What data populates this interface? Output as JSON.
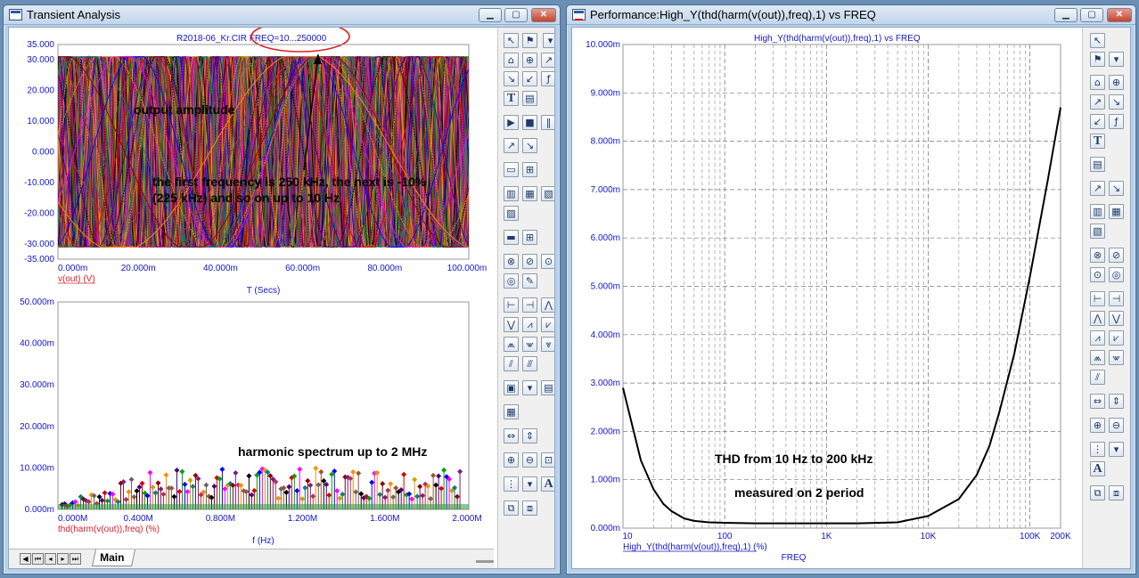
{
  "windows": {
    "transient": {
      "title": "Transient Analysis",
      "plot_title": "R2018-06_Kr.CIR  FREQ=10...250000",
      "tab_label": "Main"
    },
    "performance": {
      "title": "Performance:High_Y(thd(harm(v(out)),freq),1) vs FREQ",
      "plot_title": "High_Y(thd(harm(v(out)),freq),1) vs FREQ"
    }
  },
  "colors": {
    "axis_text": "#1515c8",
    "annotation_red": "#d8202a",
    "wave_colors": [
      "#000000",
      "#4b0082",
      "#d80000",
      "#00a000",
      "#0000ff",
      "#ff00ff",
      "#c8a000",
      "#008080",
      "#8b0000",
      "#7a1f7a",
      "#b03060",
      "#ff8c00",
      "#666666",
      "#a0522d"
    ]
  },
  "chart_data": [
    {
      "type": "line",
      "title": "R2018-06_Kr.CIR  FREQ=10...250000",
      "xlabel": "T (Secs)",
      "ylabel": "v(out) (V)",
      "xlim": [
        0,
        0.1
      ],
      "ylim": [
        -35,
        35
      ],
      "x_ticks": [
        "0.000m",
        "20.000m",
        "40.000m",
        "60.000m",
        "80.000m",
        "100.000m"
      ],
      "y_ticks": [
        "35.000",
        "30.000",
        "20.000",
        "10.000",
        "0.000",
        "-10.000",
        "-20.000",
        "-30.000",
        "-35.000"
      ],
      "amplitude": 31,
      "grid": false,
      "annotations": [
        "output amplitude",
        "the first frequency is 250 kHz, the next is -10%",
        "(225 kHz) and so on up to 10 Hz"
      ]
    },
    {
      "type": "scatter",
      "xlabel": "f (Hz)",
      "ylabel": "thd(harm(v(out)),freq) (%)",
      "xlim": [
        0,
        2000000
      ],
      "ylim": [
        0,
        0.05
      ],
      "x_ticks": [
        "0.000M",
        "0.400M",
        "0.800M",
        "1.200M",
        "1.600M",
        "2.000M"
      ],
      "y_ticks": [
        "50.000m",
        "40.000m",
        "30.000m",
        "20.000m",
        "10.000m",
        "0.000m"
      ],
      "peak_level": 0.01,
      "grid": false,
      "annotations": [
        "harmonic spectrum up to 2 MHz"
      ]
    },
    {
      "type": "line",
      "title": "High_Y(thd(harm(v(out)),freq),1) vs FREQ",
      "xlabel": "FREQ",
      "ylabel": "High_Y(thd(harm(v(out)),freq),1) (%)",
      "xscale": "log",
      "xlim": [
        10,
        200000
      ],
      "ylim": [
        0,
        0.01
      ],
      "x_ticks": [
        "10",
        "100",
        "1K",
        "10K",
        "100K",
        "200K"
      ],
      "y_ticks": [
        "10.000m",
        "9.000m",
        "8.000m",
        "7.000m",
        "6.000m",
        "5.000m",
        "4.000m",
        "3.000m",
        "2.000m",
        "1.000m",
        "0.000m"
      ],
      "grid": true,
      "series": [
        {
          "x": [
            10,
            15,
            20,
            25,
            30,
            40,
            50,
            70,
            100,
            200,
            500,
            1000,
            2000,
            5000,
            10000,
            20000,
            30000,
            40000,
            50000,
            70000,
            100000,
            150000,
            200000
          ],
          "y": [
            0.0029,
            0.0014,
            0.0008,
            0.0005,
            0.00035,
            0.0002,
            0.00015,
            0.00012,
            0.00011,
            0.0001,
            0.0001,
            0.0001,
            0.0001,
            0.00012,
            0.00025,
            0.0006,
            0.0011,
            0.0017,
            0.0024,
            0.0036,
            0.0052,
            0.0072,
            0.0087
          ]
        }
      ],
      "annotations": [
        "THD from 10 Hz to 200 kHz",
        "measured on 2 period"
      ]
    }
  ]
}
